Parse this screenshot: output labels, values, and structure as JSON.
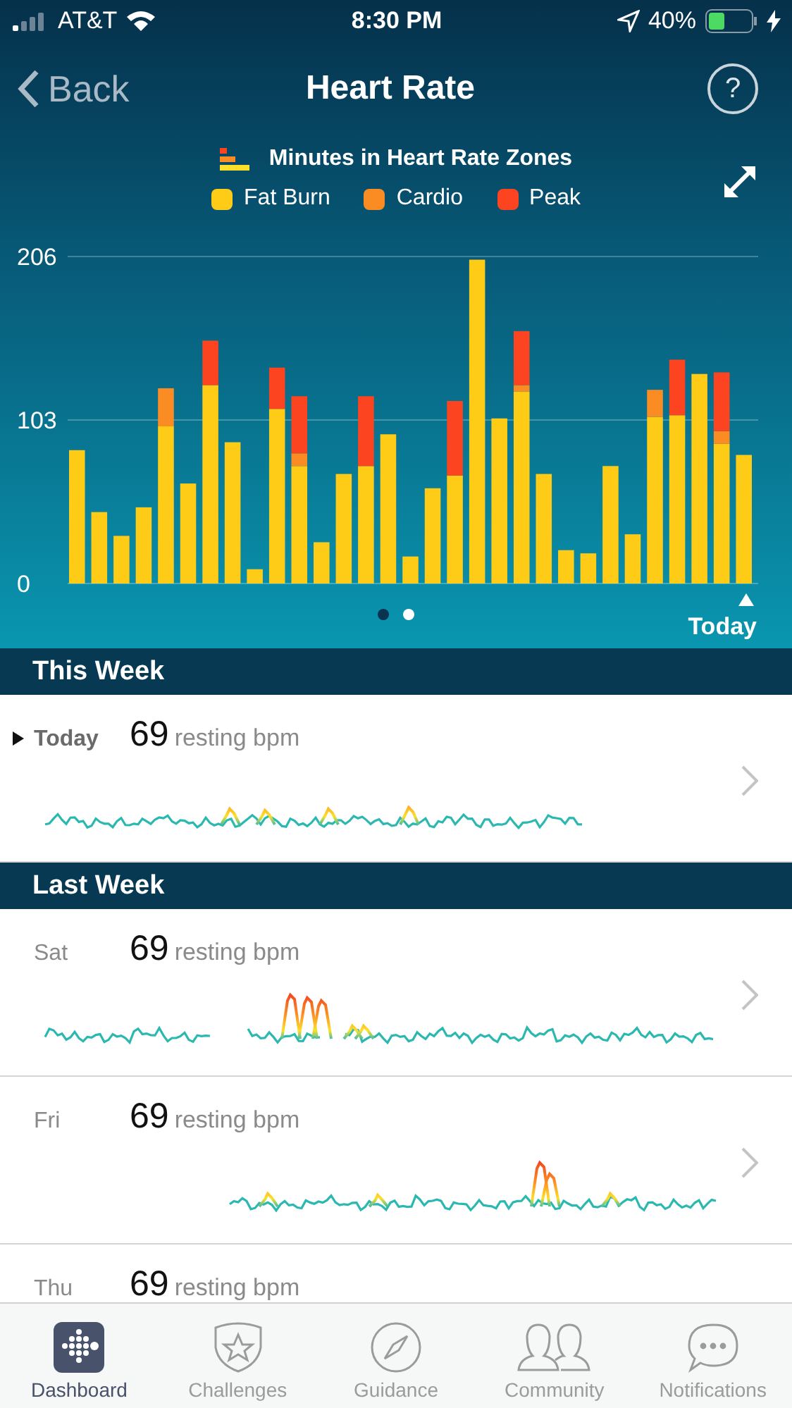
{
  "status_bar": {
    "carrier": "AT&T",
    "time": "8:30 PM",
    "battery": "40%"
  },
  "nav": {
    "back": "Back",
    "title": "Heart Rate",
    "help": "?"
  },
  "legend": {
    "title": "Minutes in Heart Rate Zones"
  },
  "chart_data": {
    "type": "bar",
    "stacked": true,
    "yticks": [
      0,
      103,
      206
    ],
    "ylim": [
      0,
      206
    ],
    "series": [
      {
        "name": "Fat Burn",
        "color": "#fecb17",
        "values": [
          84,
          45,
          30,
          48,
          99,
          63,
          125,
          89,
          9,
          110,
          74,
          26,
          69,
          74,
          94,
          17,
          60,
          68,
          204,
          104,
          121,
          69,
          21,
          19,
          74,
          31,
          105,
          106,
          132,
          88,
          81
        ]
      },
      {
        "name": "Cardio",
        "color": "#fb8c23",
        "values": [
          0,
          0,
          0,
          0,
          24,
          0,
          0,
          0,
          0,
          0,
          8,
          0,
          0,
          0,
          0,
          0,
          0,
          0,
          0,
          0,
          4,
          0,
          0,
          0,
          0,
          0,
          17,
          0,
          0,
          8,
          0
        ]
      },
      {
        "name": "Peak",
        "color": "#fc4420",
        "values": [
          0,
          0,
          0,
          0,
          0,
          0,
          28,
          0,
          0,
          26,
          36,
          0,
          0,
          44,
          0,
          0,
          0,
          47,
          0,
          0,
          34,
          0,
          0,
          0,
          0,
          0,
          0,
          35,
          0,
          37,
          0
        ]
      }
    ],
    "annotations": [
      "Today"
    ]
  },
  "pager": [
    {
      "selected": false
    },
    {
      "selected": true
    }
  ],
  "sections": [
    {
      "title": "This Week",
      "days": [
        {
          "day": "Today",
          "bpm": "69",
          "unit": "resting bpm",
          "current": true
        }
      ]
    },
    {
      "title": "Last Week",
      "days": [
        {
          "day": "Sat",
          "bpm": "69",
          "unit": "resting bpm",
          "current": false
        },
        {
          "day": "Fri",
          "bpm": "69",
          "unit": "resting bpm",
          "current": false
        },
        {
          "day": "Thu",
          "bpm": "69",
          "unit": "resting bpm",
          "current": false
        }
      ]
    }
  ],
  "tabs": [
    {
      "label": "Dashboard",
      "selected": true
    },
    {
      "label": "Challenges",
      "selected": false
    },
    {
      "label": "Guidance",
      "selected": false
    },
    {
      "label": "Community",
      "selected": false
    },
    {
      "label": "Notifications",
      "selected": false
    }
  ]
}
